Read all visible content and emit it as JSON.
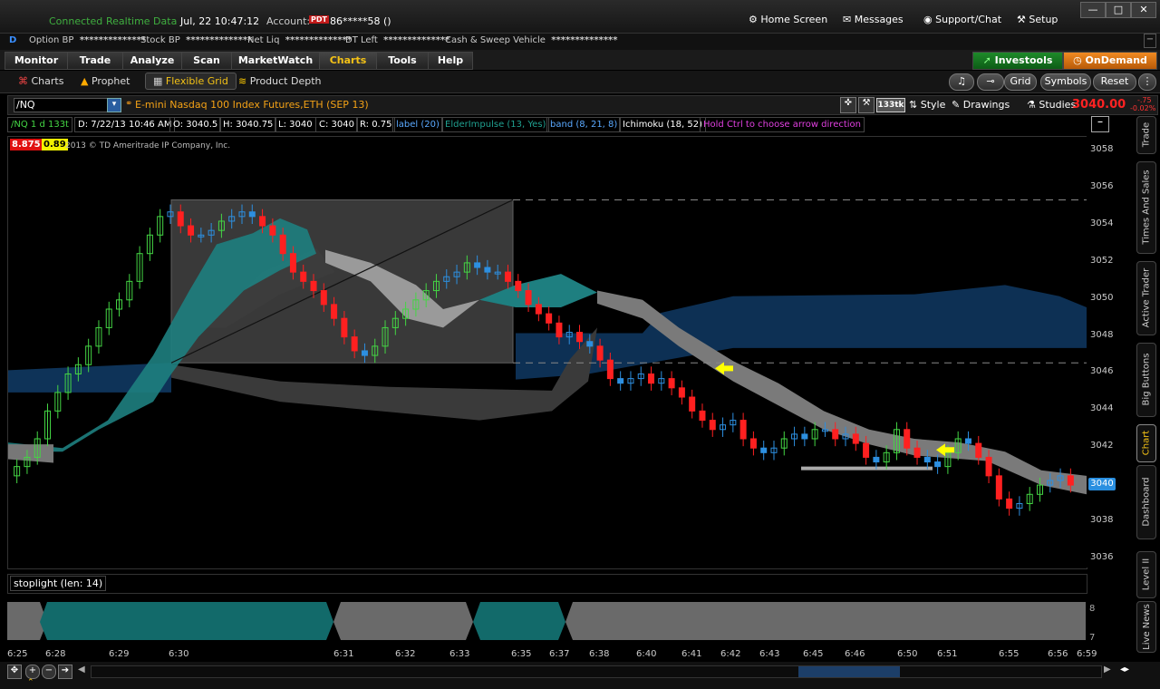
{
  "status": {
    "connected": "Connected",
    "realtime": "Realtime Data",
    "datetime": "Jul, 22  10:47:12",
    "account_label": "Account:",
    "account_badge": "PDT",
    "account": "86*****58 ()"
  },
  "top_actions": {
    "home": "Home Screen",
    "messages": "Messages",
    "support": "Support/Chat",
    "setup": "Setup"
  },
  "window_controls": {
    "minimize": "—",
    "maximize": "□",
    "close": "✕"
  },
  "infobar": {
    "badge": "D",
    "items": [
      {
        "label": "Option BP",
        "value": "**************"
      },
      {
        "label": "Stock BP",
        "value": "**************"
      },
      {
        "label": "Net Liq",
        "value": "**************"
      },
      {
        "label": "DT Left",
        "value": "**************"
      },
      {
        "label": "Cash & Sweep Vehicle",
        "value": "**************"
      }
    ]
  },
  "tabs": [
    "Monitor",
    "Trade",
    "Analyze",
    "Scan",
    "MarketWatch",
    "Charts",
    "Tools",
    "Help"
  ],
  "active_tab": "Charts",
  "brand": {
    "investools": "Investools",
    "ondemand": "OnDemand"
  },
  "subtabs": [
    "Charts",
    "Prophet",
    "Flexible Grid",
    "Product Depth"
  ],
  "active_subtab": "Flexible Grid",
  "sub_right": {
    "grid": "Grid",
    "symbols": "Symbols",
    "reset": "Reset"
  },
  "chart_header": {
    "symbol": "/NQ",
    "description": "E-mini Nasdaq 100 Index Futures,ETH (SEP 13)",
    "ticks": "133tk",
    "style": "Style",
    "drawings": "Drawings",
    "studies": "Studies",
    "last": "3040.00",
    "change": "-.75",
    "change_pct": "-0.02%"
  },
  "study_labels": [
    {
      "text": "/NQ 1 d 133t",
      "color": "#44d544"
    },
    {
      "text": "D: 7/22/13 10:46 AM",
      "color": "#ffffff"
    },
    {
      "text": "O: 3040.5",
      "color": "#ffffff"
    },
    {
      "text": "H: 3040.75",
      "color": "#ffffff"
    },
    {
      "text": "L: 3040",
      "color": "#ffffff"
    },
    {
      "text": "C: 3040",
      "color": "#ffffff"
    },
    {
      "text": "R: 0.75",
      "color": "#ffffff"
    },
    {
      "text": "label (20)",
      "color": "#5aa9ff"
    },
    {
      "text": "ElderImpulse (13, Yes)",
      "color": "#20a090"
    },
    {
      "text": "band (8, 21, 8)",
      "color": "#5aa9ff"
    },
    {
      "text": "Ichimoku (18, 52)",
      "color": "#ffffff"
    },
    {
      "text": "Hold Ctrl to choose arrow direction",
      "color": "#e040e0"
    }
  ],
  "badges": {
    "red": "8.875",
    "yellow": "0.89",
    "copyright": "2013 © TD Ameritrade IP Company, Inc."
  },
  "price_labels": [
    "3058",
    "3056",
    "3054",
    "3052",
    "3050",
    "3048",
    "3046",
    "3044",
    "3042",
    "3040",
    "3038",
    "3036"
  ],
  "current_price": "3040",
  "stoplight": {
    "label": "stoplight (len: 14)",
    "levels": [
      "8",
      "7"
    ]
  },
  "time_labels": [
    "6:25",
    "6:28",
    "6:29",
    "6:30",
    "6:31",
    "6:32",
    "6:33",
    "6:35",
    "6:37",
    "6:38",
    "6:40",
    "6:41",
    "6:42",
    "6:43",
    "6:45",
    "6:46",
    "6:50",
    "6:51",
    "6:55",
    "6:56",
    "6:59"
  ],
  "right_tabs": [
    "Trade",
    "Times And Sales",
    "Active Trader",
    "Big Buttons",
    "Chart",
    "Dashboard",
    "Level II",
    "Live News"
  ],
  "active_right_tab": "Chart",
  "colors": {
    "up": "#44d544",
    "down": "#ff2020",
    "neutral": "#2d8fe0",
    "teal_cloud": "#1e7f80",
    "gray_cloud": "#7a7a7a",
    "blue_band": "#0e3358",
    "accent": "#f4c216"
  },
  "chart_data": {
    "type": "candlestick",
    "ylim": [
      3035.5,
      3058.8
    ],
    "x_categories": [
      "6:25",
      "6:28",
      "6:29",
      "6:30",
      "6:31",
      "6:32",
      "6:33",
      "6:35",
      "6:37",
      "6:38",
      "6:40",
      "6:41",
      "6:42",
      "6:43",
      "6:45",
      "6:46",
      "6:50",
      "6:51",
      "6:55",
      "6:56",
      "6:59"
    ],
    "closes": [
      3041.0,
      3041.5,
      3042.5,
      3044.0,
      3045.0,
      3046.0,
      3046.5,
      3047.5,
      3048.5,
      3049.5,
      3050.0,
      3051.0,
      3052.5,
      3053.5,
      3054.5,
      3054.75,
      3054.0,
      3053.5,
      3053.5,
      3053.75,
      3054.25,
      3054.5,
      3054.75,
      3054.5,
      3054.0,
      3053.5,
      3052.5,
      3051.5,
      3051.0,
      3050.5,
      3049.75,
      3049.0,
      3048.0,
      3047.25,
      3047.0,
      3047.5,
      3048.5,
      3049.0,
      3049.5,
      3050.0,
      3050.5,
      3051.0,
      3051.25,
      3051.5,
      3052.0,
      3051.75,
      3051.5,
      3051.5,
      3051.0,
      3050.5,
      3049.75,
      3049.25,
      3048.75,
      3048.0,
      3048.25,
      3047.75,
      3047.5,
      3046.75,
      3045.75,
      3045.5,
      3045.75,
      3046.0,
      3045.5,
      3045.75,
      3045.25,
      3044.75,
      3044.0,
      3043.5,
      3043.0,
      3043.25,
      3043.5,
      3042.5,
      3042.0,
      3041.75,
      3042.0,
      3042.5,
      3042.75,
      3042.5,
      3043.0,
      3043.0,
      3042.5,
      3042.75,
      3042.25,
      3041.5,
      3041.25,
      3041.75,
      3043.0,
      3042.0,
      3041.5,
      3041.25,
      3041.0,
      3041.75,
      3042.5,
      3042.25,
      3041.5,
      3040.5,
      3039.25,
      3038.75,
      3039.0,
      3039.5,
      3040.0,
      3040.25,
      3040.5,
      3040.0
    ],
    "ichimoku_band_levels": [
      3046.5,
      3036.0
    ]
  }
}
